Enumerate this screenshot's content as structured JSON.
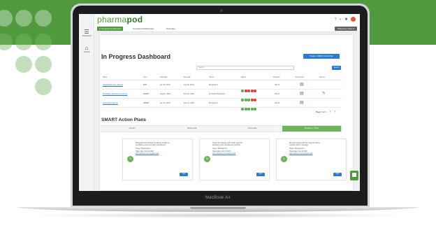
{
  "app": {
    "logo_light": "pharma",
    "logo_bold": "pod"
  },
  "sidebar": {
    "items": [
      {
        "label": "Dashboard",
        "icon": "menu-icon"
      },
      {
        "label": "Training",
        "icon": "cap-icon"
      }
    ]
  },
  "tabs": [
    {
      "label": "In Progress Dashboard",
      "active": true
    },
    {
      "label": "Completed Dashboard",
      "active": false
    },
    {
      "label": "Preceptor",
      "active": false
    }
  ],
  "breadcrumb": "Pharmacy name ▾",
  "header": {
    "title": "In Progress Dashboard",
    "create_label": "Create a SMART Action Plan",
    "search_placeholder": "Search",
    "search_button": "Search"
  },
  "table": {
    "columns": [
      "Name",
      "Type",
      "Start date",
      "Due date",
      "Owner",
      "Status",
      "Progress",
      "Documents",
      "Actions"
    ],
    "rows": [
      {
        "name": "Clinical Pharmacy Review",
        "type": "PDP",
        "start": "Jun 18, 2019",
        "due": "Jun 26, 2019",
        "owner": "Preceptor 1",
        "progress": "100 %",
        "status_colors": [
          "#4caf50",
          "#e53935",
          "#e53935",
          "#e53935",
          "#e53935"
        ]
      },
      {
        "name": "Medication Review Assessment",
        "type": "SMART",
        "start": "Aug 10, 2019",
        "due": "Feb 10, 2020",
        "owner": "Dr Smith Pharmacist",
        "progress": "100 %",
        "status_colors": [
          "#4caf50",
          "#4caf50",
          "#4caf50",
          "#e53935",
          "#e53935"
        ]
      },
      {
        "name": "Vaccination Service",
        "type": "SMART",
        "start": "Jun 14, 2019",
        "due": "Dec 14, 2019",
        "owner": "Preceptor 1",
        "progress": "100 %",
        "status_colors": [
          "#4caf50",
          "#4caf50",
          "#4caf50",
          "#4caf50",
          "#4caf50"
        ]
      }
    ],
    "pager": "Page 1 of 1"
  },
  "smart": {
    "title": "SMART Action Plans",
    "steps": [
      "Specific",
      "Measurable",
      "Achievable",
      "Realistic & Timely"
    ],
    "active_step": 3,
    "cards": [
      {
        "badge": "S",
        "line1": "Pharmacist will complete the training module on",
        "line2": "medication review and patient assessment.",
        "line3": "Owner: Pharmacist 1",
        "line4": "Target date: Feb 10 2020",
        "link": "Add evidence and complete task",
        "button": "Edit"
      },
      {
        "badge": "M",
        "line1": "Assess five patients each month using the",
        "line2": "standard review template and checklist.",
        "line3": "Owner: Pharmacist 1",
        "line4": "Target date: Feb 10 2020",
        "link": "Add evidence and complete task",
        "button": "Edit"
      },
      {
        "badge": "A",
        "line1": "Discuss progress with the preceptor during",
        "line2": "monthly check-in meetings.",
        "line3": "Owner: Pharmacist 1",
        "line4": "Target date: Feb 10 2020",
        "link": "Add evidence and complete task",
        "button": "Edit"
      }
    ]
  },
  "device_label": "MacBook Air",
  "colors": {
    "brand_green": "#4f9a3d",
    "accent_blue": "#2b7ad6",
    "status_green": "#4caf50",
    "status_red": "#e53935"
  }
}
